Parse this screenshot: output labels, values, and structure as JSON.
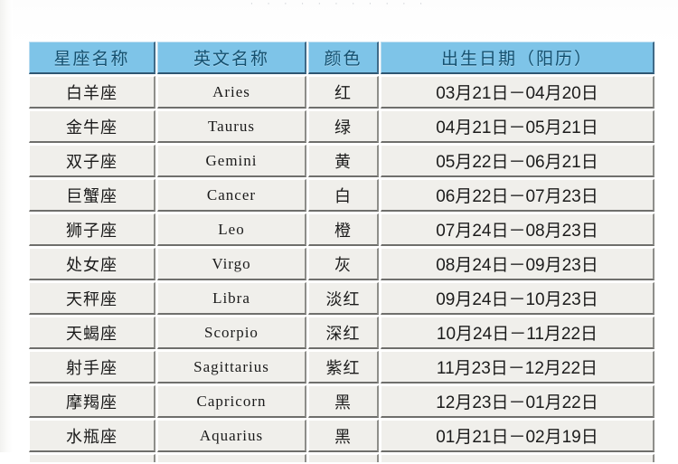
{
  "page": {
    "top_sliver_text": "· · · · ·    · ·    · · · ·"
  },
  "table": {
    "columns": [
      {
        "key": "name",
        "label": "星座名称"
      },
      {
        "key": "en",
        "label": "英文名称"
      },
      {
        "key": "color",
        "label": "颜色"
      },
      {
        "key": "date",
        "label": "出生日期（阳历）"
      }
    ],
    "header_bg": "#7ec4e8",
    "cell_bg": "#f0efeb",
    "rows": [
      {
        "name": "白羊座",
        "en": "Aries",
        "color": "红",
        "date": "03月21日－04月20日"
      },
      {
        "name": "金牛座",
        "en": "Taurus",
        "color": "绿",
        "date": "04月21日－05月21日"
      },
      {
        "name": "双子座",
        "en": "Gemini",
        "color": "黄",
        "date": "05月22日－06月21日"
      },
      {
        "name": "巨蟹座",
        "en": "Cancer",
        "color": "白",
        "date": "06月22日－07月23日"
      },
      {
        "name": "狮子座",
        "en": "Leo",
        "color": "橙",
        "date": "07月24日－08月23日"
      },
      {
        "name": "处女座",
        "en": "Virgo",
        "color": "灰",
        "date": "08月24日－09月23日"
      },
      {
        "name": "天秤座",
        "en": "Libra",
        "color": "淡红",
        "date": "09月24日－10月23日"
      },
      {
        "name": "天蝎座",
        "en": "Scorpio",
        "color": "深红",
        "date": "10月24日－11月22日"
      },
      {
        "name": "射手座",
        "en": "Sagittarius",
        "color": "紫红",
        "date": "11月23日－12月22日"
      },
      {
        "name": "摩羯座",
        "en": "Capricorn",
        "color": "黑",
        "date": "12月23日－01月22日"
      },
      {
        "name": "水瓶座",
        "en": "Aquarius",
        "color": "黑",
        "date": "01月21日－02月19日"
      }
    ],
    "clipped_row": {
      "name": "",
      "en": "",
      "color": "",
      "date": ""
    }
  }
}
